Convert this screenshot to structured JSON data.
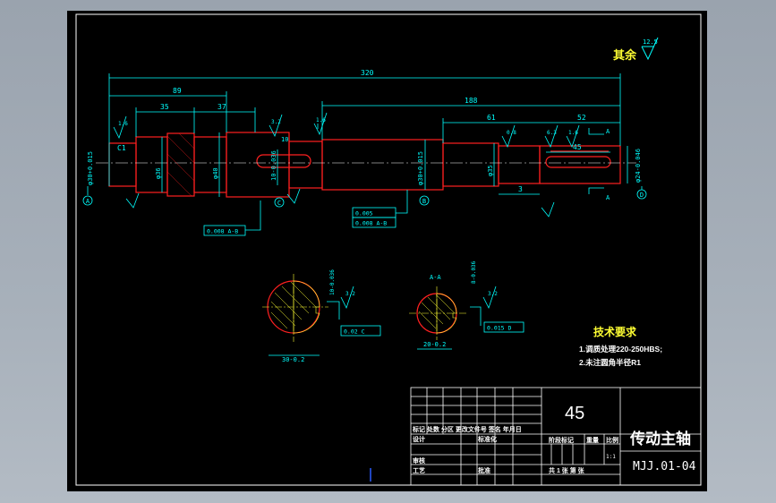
{
  "surface_finish": {
    "label": "其余",
    "value": "12.5"
  },
  "dimensions": {
    "overall": "320",
    "d89": "89",
    "d35": "35",
    "d37": "37",
    "d188": "188",
    "d61": "61",
    "d52": "52",
    "d45": "45",
    "d3": "3",
    "d10": "10",
    "chamfer_c1": "C1",
    "dia_left": "φ30+0.015",
    "dia_36": "φ36",
    "dia_40": "φ40",
    "dia_mid": "φ30+0.015",
    "dia_35": "φ35",
    "dia_right": "φ24-0.046",
    "key_width": "10-0.036",
    "sec_c_depth": "30-0.2",
    "sec_a_key": "8-0.036",
    "sec_a_depth": "20-0.2"
  },
  "roughness": {
    "r1": "1.6",
    "r2": "3.2",
    "r3": "1.6",
    "r4": "0.8",
    "r5": "6.3",
    "r6": "1.6",
    "r7": "3.2",
    "r8": "3.2",
    "r9": "3.2",
    "r10": "3.2",
    "r11": "6.3"
  },
  "datums": {
    "a": "A",
    "b": "B",
    "c": "C",
    "d": "D"
  },
  "section_labels": {
    "aa": "A-A",
    "a_arrow_top": "A",
    "a_arrow_bot": "A"
  },
  "tolerances": {
    "runout": "0.008  A-B",
    "cyl1": "0.005",
    "cyl2": "0.008  A-B",
    "sym_c": "0.02  C",
    "sym_d": "0.015  D"
  },
  "tech_requirements": {
    "title": "技术要求",
    "item1": "1.调质处理220-250HBS;",
    "item2": "2.未注圆角半径R1"
  },
  "title_block": {
    "material": "45",
    "part_name": "传动主轴",
    "drawing_no": "MJJ.01-04",
    "row_labels": "标记 处数 分区 更改文件号 签名 年月日",
    "design": "设计",
    "standardize": "标准化",
    "stage_mark": "阶段标记",
    "weight": "重量",
    "scale": "比例",
    "scale_value": "1:1",
    "review": "审核",
    "process": "工艺",
    "approve": "批准",
    "sheets": "共 1 张  第  张"
  }
}
